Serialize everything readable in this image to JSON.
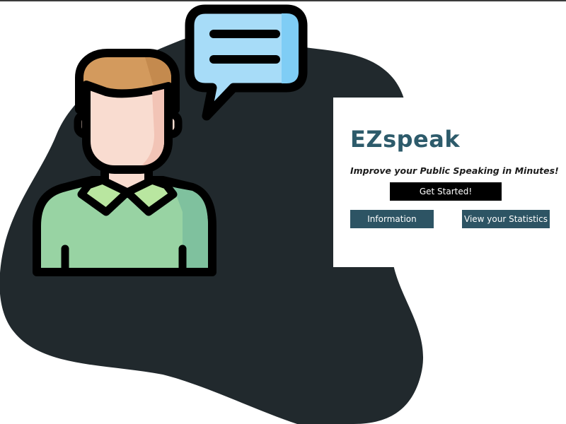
{
  "app": {
    "brand": "EZspeak",
    "tagline": "Improve your Public Speaking in Minutes!"
  },
  "actions": {
    "get_started_label": "Get Started!",
    "information_label": "Information",
    "statistics_label": "View your Statistics"
  },
  "colors": {
    "blob": "#21292d",
    "brand_text": "#2d5b6b",
    "secondary_button": "#2d5464",
    "primary_button": "#000000",
    "bubble": "#a7dcf8",
    "shirt": "#98d3a3",
    "hair": "#d39a5d",
    "skin": "#f9dcd0"
  },
  "illustration": {
    "person_icon": "person-avatar-icon",
    "chat_icon": "speech-bubble-icon"
  }
}
